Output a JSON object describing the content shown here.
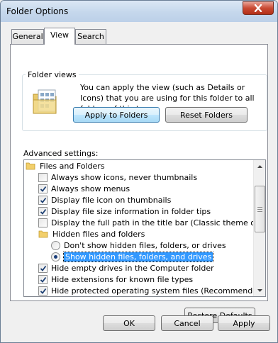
{
  "window": {
    "title": "Folder Options"
  },
  "tabs": [
    {
      "label": "General",
      "active": false
    },
    {
      "label": "View",
      "active": true
    },
    {
      "label": "Search",
      "active": false
    }
  ],
  "folder_views": {
    "legend": "Folder views",
    "description": "You can apply the view (such as Details or Icons) that you are using for this folder to all folders of this type.",
    "apply_button": "Apply to Folders",
    "reset_button": "Reset Folders"
  },
  "advanced": {
    "label": "Advanced settings:",
    "items": [
      {
        "type": "folder",
        "label": "Files and Folders"
      },
      {
        "type": "checkbox",
        "label": "Always show icons, never thumbnails",
        "checked": false
      },
      {
        "type": "checkbox",
        "label": "Always show menus",
        "checked": true
      },
      {
        "type": "checkbox",
        "label": "Display file icon on thumbnails",
        "checked": true
      },
      {
        "type": "checkbox",
        "label": "Display file size information in folder tips",
        "checked": true
      },
      {
        "type": "checkbox",
        "label": "Display the full path in the title bar (Classic theme only)",
        "checked": false
      },
      {
        "type": "folder",
        "label": "Hidden files and folders"
      },
      {
        "type": "radio",
        "label": "Don't show hidden files, folders, or drives",
        "checked": false
      },
      {
        "type": "radio",
        "label": "Show hidden files, folders, and drives",
        "checked": true,
        "selected": true
      },
      {
        "type": "checkbox",
        "label": "Hide empty drives in the Computer folder",
        "checked": true
      },
      {
        "type": "checkbox",
        "label": "Hide extensions for known file types",
        "checked": true
      },
      {
        "type": "checkbox",
        "label": "Hide protected operating system files (Recommended)",
        "checked": true
      }
    ]
  },
  "restore_button": "Restore Defaults",
  "footer": {
    "ok": "OK",
    "cancel": "Cancel",
    "apply": "Apply"
  },
  "colors": {
    "selection": "#3399ff",
    "close_button": "#c94a33",
    "titlebar": "#c5d7ec"
  }
}
